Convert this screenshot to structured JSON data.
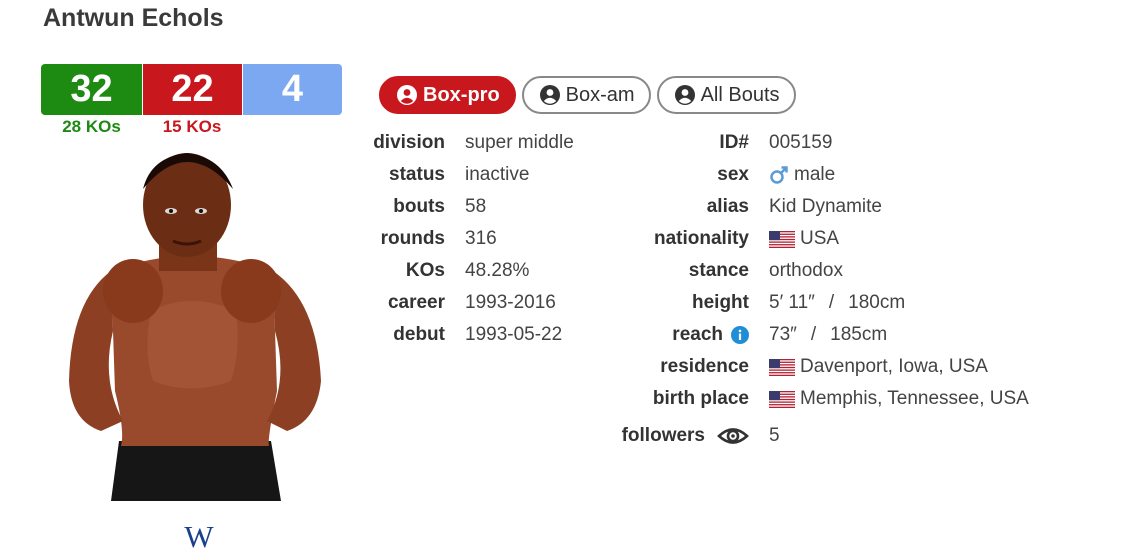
{
  "boxer": {
    "name": "Antwun Echols"
  },
  "record": {
    "wins": "32",
    "wins_kos": "28 KOs",
    "losses": "22",
    "losses_kos": "15 KOs",
    "draws": "4",
    "colors": {
      "win": "#1d8a12",
      "loss": "#c8181e",
      "draw": "#7ba8f0"
    }
  },
  "photo": {
    "icon": "boxer-photo"
  },
  "wiki": {
    "glyph": "W",
    "icon": "wikipedia-icon"
  },
  "tabs": [
    {
      "label": "Box-pro",
      "active": true,
      "icon": "user-circle-icon"
    },
    {
      "label": "Box-am",
      "active": false,
      "icon": "user-circle-icon"
    },
    {
      "label": "All Bouts",
      "active": false,
      "icon": "user-circle-icon"
    }
  ],
  "left_info": [
    {
      "label": "division",
      "value": "super middle"
    },
    {
      "label": "status",
      "value": "inactive"
    },
    {
      "label": "bouts",
      "value": "58"
    },
    {
      "label": "rounds",
      "value": "316"
    },
    {
      "label": "KOs",
      "value": "48.28%"
    },
    {
      "label": "career",
      "value": "1993-2016"
    },
    {
      "label": "debut",
      "value": "1993-05-22"
    }
  ],
  "right_info": {
    "id": {
      "label": "ID#",
      "value": "005159"
    },
    "sex": {
      "label": "sex",
      "value": "male",
      "icon": "male-symbol-icon"
    },
    "alias": {
      "label": "alias",
      "value": "Kid Dynamite"
    },
    "nationality": {
      "label": "nationality",
      "value": "USA",
      "icon": "us-flag-icon"
    },
    "stance": {
      "label": "stance",
      "value": "orthodox"
    },
    "height": {
      "label": "height",
      "imperial": "5′ 11″",
      "sep": "/",
      "metric": "180cm"
    },
    "reach": {
      "label": "reach",
      "imperial": "73″",
      "sep": "/",
      "metric": "185cm",
      "icon": "info-icon"
    },
    "residence": {
      "label": "residence",
      "value": "Davenport, Iowa, USA",
      "icon": "us-flag-icon"
    },
    "birth_place": {
      "label": "birth place",
      "value": "Memphis, Tennessee, USA",
      "icon": "us-flag-icon"
    },
    "followers": {
      "label": "followers",
      "value": "5",
      "icon": "eye-icon"
    }
  }
}
